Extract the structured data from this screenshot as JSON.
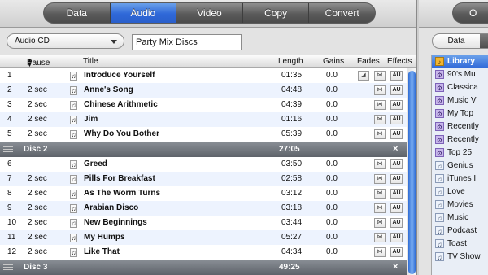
{
  "tabs": [
    {
      "label": "Data",
      "active": false
    },
    {
      "label": "Audio",
      "active": true
    },
    {
      "label": "Video",
      "active": false
    },
    {
      "label": "Copy",
      "active": false
    },
    {
      "label": "Convert",
      "active": false
    }
  ],
  "right_tab_label": "O",
  "disc_type": {
    "selected": "Audio CD"
  },
  "disc_name": {
    "value": "Party Mix Discs"
  },
  "columns": {
    "pause": "Pause",
    "title": "Title",
    "length": "Length",
    "gains": "Gains",
    "fades": "Fades",
    "effects": "Effects"
  },
  "discs": [
    {
      "tracks": [
        {
          "num": "1",
          "pause": "",
          "title": "Introduce Yourself",
          "length": "01:35",
          "gain": "0.0",
          "fade_in": "◢",
          "fade_out": "⋈",
          "effect": "AU"
        },
        {
          "num": "2",
          "pause": "2 sec",
          "title": "Anne's Song",
          "length": "04:48",
          "gain": "0.0",
          "fade_in": "",
          "fade_out": "⋈",
          "effect": "AU"
        },
        {
          "num": "3",
          "pause": "2 sec",
          "title": "Chinese Arithmetic",
          "length": "04:39",
          "gain": "0.0",
          "fade_in": "",
          "fade_out": "⋈",
          "effect": "AU"
        },
        {
          "num": "4",
          "pause": "2 sec",
          "title": "Jim",
          "length": "01:16",
          "gain": "0.0",
          "fade_in": "",
          "fade_out": "⋈",
          "effect": "AU"
        },
        {
          "num": "5",
          "pause": "2 sec",
          "title": "Why Do You Bother",
          "length": "05:39",
          "gain": "0.0",
          "fade_in": "",
          "fade_out": "⋈",
          "effect": "AU"
        }
      ],
      "separator": {
        "label": "Disc 2",
        "total": "27:05",
        "close": "×"
      }
    },
    {
      "tracks": [
        {
          "num": "6",
          "pause": "",
          "title": "Greed",
          "length": "03:50",
          "gain": "0.0",
          "fade_in": "",
          "fade_out": "⋈",
          "effect": "AU"
        },
        {
          "num": "7",
          "pause": "2 sec",
          "title": "Pills For Breakfast",
          "length": "02:58",
          "gain": "0.0",
          "fade_in": "",
          "fade_out": "⋈",
          "effect": "AU"
        },
        {
          "num": "8",
          "pause": "2 sec",
          "title": "As The Worm Turns",
          "length": "03:12",
          "gain": "0.0",
          "fade_in": "",
          "fade_out": "⋈",
          "effect": "AU"
        },
        {
          "num": "9",
          "pause": "2 sec",
          "title": "Arabian Disco",
          "length": "03:18",
          "gain": "0.0",
          "fade_in": "",
          "fade_out": "⋈",
          "effect": "AU"
        },
        {
          "num": "10",
          "pause": "2 sec",
          "title": "New Beginnings",
          "length": "03:44",
          "gain": "0.0",
          "fade_in": "",
          "fade_out": "⋈",
          "effect": "AU"
        },
        {
          "num": "11",
          "pause": "2 sec",
          "title": "My Humps",
          "length": "05:27",
          "gain": "0.0",
          "fade_in": "",
          "fade_out": "⋈",
          "effect": "AU"
        },
        {
          "num": "12",
          "pause": "2 sec",
          "title": "Like That",
          "length": "04:34",
          "gain": "0.0",
          "fade_in": "",
          "fade_out": "⋈",
          "effect": "AU"
        }
      ],
      "separator": {
        "label": "Disc 3",
        "total": "49:25",
        "close": "×"
      }
    }
  ],
  "right_panel": {
    "segment_label": "Data",
    "library": [
      {
        "label": "Library",
        "icon": "library-icon",
        "selected": true
      },
      {
        "label": "90's Mu",
        "icon": "smart-playlist-icon"
      },
      {
        "label": "Classica",
        "icon": "smart-playlist-icon"
      },
      {
        "label": "Music V",
        "icon": "smart-playlist-icon"
      },
      {
        "label": "My Top",
        "icon": "smart-playlist-icon"
      },
      {
        "label": "Recently",
        "icon": "smart-playlist-icon"
      },
      {
        "label": "Recently",
        "icon": "smart-playlist-icon"
      },
      {
        "label": "Top 25",
        "icon": "smart-playlist-icon"
      },
      {
        "label": "Genius",
        "icon": "playlist-icon"
      },
      {
        "label": "iTunes I",
        "icon": "playlist-icon"
      },
      {
        "label": "Love",
        "icon": "playlist-icon"
      },
      {
        "label": "Movies",
        "icon": "playlist-icon"
      },
      {
        "label": "Music",
        "icon": "playlist-icon"
      },
      {
        "label": "Podcast",
        "icon": "playlist-icon"
      },
      {
        "label": "Toast",
        "icon": "playlist-icon"
      },
      {
        "label": "TV Show",
        "icon": "playlist-icon"
      }
    ]
  },
  "colors": {
    "accent": "#2f68d8",
    "row_alt": "#edf3fe",
    "disc_separator": "#5e636a"
  }
}
